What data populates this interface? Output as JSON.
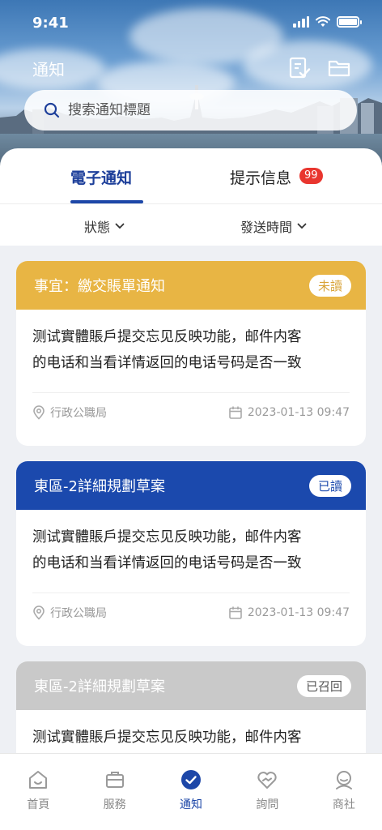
{
  "status_bar": {
    "time": "9:41"
  },
  "header": {
    "title": "通知",
    "search_placeholder": "搜索通知標題"
  },
  "tabs": [
    {
      "label": "電子通知",
      "active": true
    },
    {
      "label": "提示信息",
      "badge": "99",
      "active": false
    }
  ],
  "filters": [
    {
      "label": "狀態"
    },
    {
      "label": "發送時間"
    }
  ],
  "cards": [
    {
      "title": "事宜：繳交賬單通知",
      "status": "未讀",
      "header_color": "#e8b544",
      "status_color": "#d9a43a",
      "body_line1": "测试實體賬戶提交忘见反映功能，邮件内客",
      "body_line2": "的电话和当看详情返回的电话号码是否一致",
      "department": "行政公職局",
      "datetime": "2023-01-13 09:47"
    },
    {
      "title": "東區-2詳細規劃草案",
      "status": "已讀",
      "header_color": "#1b49ad",
      "status_color": "#1b49ad",
      "body_line1": "测试實體賬戶提交忘见反映功能，邮件内客",
      "body_line2": "的电话和当看详情返回的电话号码是否一致",
      "department": "行政公職局",
      "datetime": "2023-01-13 09:47"
    },
    {
      "title": "東區-2詳細規劃草案",
      "status": "已召回",
      "header_color": "#c9c9c9",
      "status_color": "#555555",
      "body_line1": "测试實體賬戶提交忘见反映功能，邮件内客",
      "body_line2": "",
      "department": "",
      "datetime": ""
    }
  ],
  "bottom_nav": [
    {
      "label": "首頁",
      "icon": "home-icon",
      "active": false
    },
    {
      "label": "服務",
      "icon": "briefcase-icon",
      "active": false
    },
    {
      "label": "通知",
      "icon": "bell-check-icon",
      "active": true
    },
    {
      "label": "詢問",
      "icon": "heart-chat-icon",
      "active": false
    },
    {
      "label": "商社",
      "icon": "person-icon",
      "active": false
    }
  ],
  "colors": {
    "primary": "#1d47a8",
    "badge": "#e9362f"
  }
}
